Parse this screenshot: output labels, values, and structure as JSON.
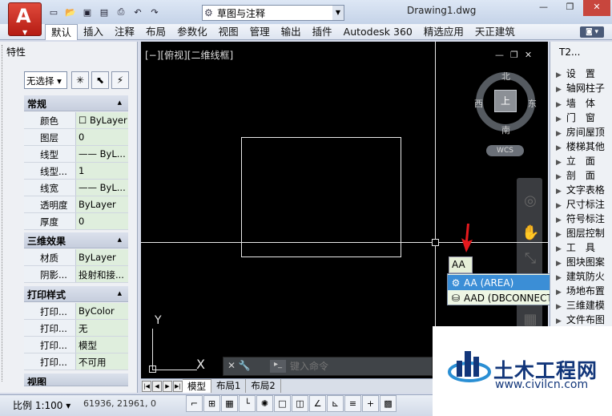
{
  "app": {
    "document_title": "Drawing1.dwg",
    "workspace": "草图与注释"
  },
  "ribbon": {
    "tabs": [
      "默认",
      "插入",
      "注释",
      "布局",
      "参数化",
      "视图",
      "管理",
      "输出",
      "插件",
      "Autodesk 360",
      "精选应用",
      "天正建筑"
    ]
  },
  "properties": {
    "title": "特性",
    "selection": "无选择",
    "sections": [
      {
        "title": "常规",
        "rows": [
          {
            "label": "颜色",
            "value": "ByLayer"
          },
          {
            "label": "图层",
            "value": "0"
          },
          {
            "label": "线型",
            "value": "—— ByL..."
          },
          {
            "label": "线型...",
            "value": "1"
          },
          {
            "label": "线宽",
            "value": "—— ByL..."
          },
          {
            "label": "透明度",
            "value": "ByLayer"
          },
          {
            "label": "厚度",
            "value": "0"
          }
        ]
      },
      {
        "title": "三维效果",
        "rows": [
          {
            "label": "材质",
            "value": "ByLayer"
          },
          {
            "label": "阴影...",
            "value": "投射和接..."
          }
        ]
      },
      {
        "title": "打印样式",
        "rows": [
          {
            "label": "打印...",
            "value": "ByColor"
          },
          {
            "label": "打印...",
            "value": "无"
          },
          {
            "label": "打印...",
            "value": "模型"
          },
          {
            "label": "打印...",
            "value": "不可用"
          }
        ]
      },
      {
        "title": "视图"
      }
    ]
  },
  "viewport": {
    "label": "[−][俯视][二维线框]",
    "viewcube": {
      "top": "上",
      "north": "北",
      "south": "南",
      "east": "东",
      "west": "西",
      "wcs": "WCS"
    },
    "ucs": {
      "x": "X",
      "y": "Y"
    }
  },
  "command": {
    "typed": "AA",
    "placeholder": "键入命令",
    "autocomplete": [
      {
        "text": "AA (AREA)",
        "icon": "gear-icon",
        "highlighted": true
      },
      {
        "text": "AAD (DBCONNECT)",
        "icon": "database-icon",
        "highlighted": false
      }
    ]
  },
  "layout_tabs": [
    "模型",
    "布局1",
    "布局2"
  ],
  "right_panel": {
    "title": "T2...",
    "items": [
      "设　置",
      "轴网柱子",
      "墙　体",
      "门　窗",
      "房间屋顶",
      "楼梯其他",
      "立　面",
      "剖　面",
      "文字表格",
      "尺寸标注",
      "符号标注",
      "图层控制",
      "工　具",
      "图块图案",
      "建筑防火",
      "场地布置",
      "三维建模",
      "文件布图"
    ]
  },
  "status": {
    "scale": "比例 1:100",
    "coords": "61936, 21961, 0"
  },
  "watermark": {
    "name": "土木工程网",
    "url": "www.civilcn.com"
  },
  "colors": {
    "highlight": "#3b8ed6",
    "canvas": "#000000",
    "close": "#c8463d",
    "watermark": "#12367a"
  }
}
